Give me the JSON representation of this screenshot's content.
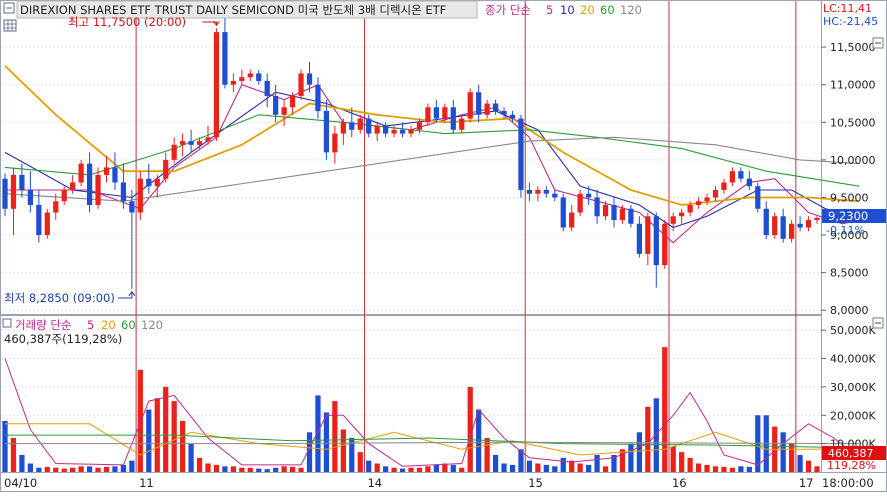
{
  "header": {
    "title": "DIREXION SHARES ETF TRUST DAILY SEMICOND  미국 반도체 3배 디렉시온 ETF",
    "ma_label": "종가 단순",
    "ma_periods": [
      "5",
      "10",
      "20",
      "60",
      "120"
    ],
    "lc": "LC:11,41",
    "hc": "HC:-21,45"
  },
  "volume_header": {
    "label": "거래량 단순",
    "ma_periods": [
      "5",
      "20",
      "60",
      "120"
    ],
    "value": "460,387주(119,28%)"
  },
  "annotations": {
    "high": "최고 11,7500 (20:00)",
    "low": "최저 8,2850 (09:00)"
  },
  "price_axis": {
    "ticks": [
      "11,5000",
      "11,0000",
      "10,5000",
      "10,0000",
      "9,5000",
      "9,0000",
      "8,5000",
      "8,0000"
    ],
    "current": "9,2300",
    "change": "-0,11%"
  },
  "volume_axis": {
    "ticks": [
      "50,000K",
      "40,000K",
      "30,000K",
      "20,000K",
      "10,000K"
    ],
    "current": "460,387",
    "pct": "119,28%"
  },
  "time_axis": {
    "labels": [
      "04/10",
      "11",
      "14",
      "15",
      "16",
      "17",
      "18:00:00"
    ]
  },
  "colors": {
    "up": "#e8231b",
    "down": "#1f4fd1",
    "ma5": "#c0288c",
    "ma10": "#2a2aa8",
    "ma20": "#e0a000",
    "ma60": "#2e9a3a",
    "ma120": "#8a8a8a",
    "session": "#c8323c"
  },
  "chart_data": {
    "type": "candlestick",
    "title": "DIREXION SHARES ETF TRUST DAILY SEMICOND  미국 반도체 3배 디렉시온 ETF",
    "ylim": [
      7.95,
      12.1
    ],
    "volume_ylim": [
      0,
      55000
    ],
    "session_labels": [
      "04/10",
      "11",
      "14",
      "15",
      "16",
      "17"
    ],
    "candles": [
      [
        9.75,
        9.82,
        9.25,
        9.35,
        18000
      ],
      [
        9.35,
        9.9,
        9.0,
        9.8,
        12000
      ],
      [
        9.8,
        9.95,
        9.5,
        9.6,
        6000
      ],
      [
        9.6,
        9.85,
        9.3,
        9.4,
        3000
      ],
      [
        9.4,
        9.6,
        8.9,
        9.0,
        1500
      ],
      [
        9.0,
        9.35,
        8.95,
        9.3,
        1800
      ],
      [
        9.3,
        9.55,
        9.2,
        9.45,
        1500
      ],
      [
        9.45,
        9.65,
        9.4,
        9.6,
        1200
      ],
      [
        9.6,
        9.8,
        9.55,
        9.7,
        1500
      ],
      [
        9.7,
        10.0,
        9.65,
        9.95,
        2000
      ],
      [
        9.95,
        10.1,
        9.3,
        9.4,
        2000
      ],
      [
        9.4,
        9.9,
        9.35,
        9.8,
        1500
      ],
      [
        9.8,
        10.05,
        9.7,
        9.9,
        1800
      ],
      [
        9.9,
        10.1,
        9.6,
        9.7,
        2000
      ],
      [
        9.7,
        9.95,
        9.35,
        9.45,
        2500
      ],
      [
        9.45,
        9.6,
        8.285,
        9.3,
        4000
      ],
      [
        9.3,
        9.85,
        9.2,
        9.75,
        36000
      ],
      [
        9.75,
        9.95,
        9.55,
        9.65,
        22000
      ],
      [
        9.65,
        9.8,
        9.5,
        9.75,
        26000
      ],
      [
        9.75,
        10.1,
        9.7,
        10.0,
        30000
      ],
      [
        10.0,
        10.3,
        9.95,
        10.2,
        25000
      ],
      [
        10.2,
        10.35,
        10.05,
        10.25,
        18000
      ],
      [
        10.25,
        10.4,
        10.1,
        10.2,
        10000
      ],
      [
        10.2,
        10.3,
        10.15,
        10.25,
        5000
      ],
      [
        10.25,
        10.45,
        10.2,
        10.3,
        3000
      ],
      [
        10.3,
        11.75,
        10.25,
        11.7,
        2500
      ],
      [
        11.7,
        11.9,
        10.95,
        11.0,
        2000
      ],
      [
        11.0,
        11.15,
        10.9,
        11.05,
        2000
      ],
      [
        11.05,
        11.2,
        11.0,
        11.1,
        1500
      ],
      [
        11.1,
        11.2,
        11.05,
        11.15,
        1500
      ],
      [
        11.15,
        11.2,
        11.0,
        11.05,
        1200
      ],
      [
        11.05,
        11.15,
        10.7,
        10.85,
        1000
      ],
      [
        10.85,
        11.0,
        10.5,
        10.6,
        1500
      ],
      [
        10.6,
        10.8,
        10.45,
        10.7,
        2000
      ],
      [
        10.7,
        10.9,
        10.6,
        10.85,
        1800
      ],
      [
        10.85,
        11.2,
        10.8,
        11.15,
        1500
      ],
      [
        11.15,
        11.3,
        10.9,
        11.0,
        14000
      ],
      [
        11.0,
        11.1,
        10.55,
        10.65,
        27000
      ],
      [
        10.65,
        10.8,
        10.0,
        10.1,
        21000
      ],
      [
        10.1,
        10.45,
        9.95,
        10.35,
        25000
      ],
      [
        10.35,
        10.55,
        10.2,
        10.5,
        15000
      ],
      [
        10.5,
        10.7,
        10.3,
        10.4,
        12000
      ],
      [
        10.4,
        10.6,
        10.35,
        10.55,
        7000
      ],
      [
        10.55,
        10.6,
        10.3,
        10.35,
        4000
      ],
      [
        10.35,
        10.5,
        10.25,
        10.45,
        3000
      ],
      [
        10.45,
        10.5,
        10.3,
        10.35,
        2000
      ],
      [
        10.35,
        10.45,
        10.3,
        10.4,
        1500
      ],
      [
        10.4,
        10.5,
        10.3,
        10.35,
        1200
      ],
      [
        10.35,
        10.45,
        10.3,
        10.4,
        1500
      ],
      [
        10.4,
        10.55,
        10.35,
        10.5,
        1500
      ],
      [
        10.5,
        10.75,
        10.45,
        10.7,
        2000
      ],
      [
        10.7,
        10.8,
        10.5,
        10.55,
        2500
      ],
      [
        10.55,
        10.75,
        10.5,
        10.7,
        3000
      ],
      [
        10.7,
        10.8,
        10.35,
        10.4,
        2500
      ],
      [
        10.4,
        10.6,
        10.35,
        10.55,
        1500
      ],
      [
        10.55,
        10.95,
        10.5,
        10.9,
        30000
      ],
      [
        10.9,
        11.0,
        10.5,
        10.6,
        22000
      ],
      [
        10.6,
        10.8,
        10.55,
        10.75,
        12000
      ],
      [
        10.75,
        10.8,
        10.6,
        10.65,
        6000
      ],
      [
        10.65,
        10.7,
        10.55,
        10.6,
        3000
      ],
      [
        10.6,
        10.65,
        10.5,
        10.55,
        2500
      ],
      [
        10.55,
        10.6,
        9.5,
        9.6,
        8000
      ],
      [
        9.6,
        9.7,
        9.45,
        9.55,
        4000
      ],
      [
        9.55,
        9.65,
        9.45,
        9.6,
        3000
      ],
      [
        9.6,
        9.65,
        9.5,
        9.55,
        2500
      ],
      [
        9.55,
        9.6,
        9.45,
        9.5,
        2000
      ],
      [
        9.5,
        9.55,
        9.05,
        9.1,
        5000
      ],
      [
        9.1,
        9.4,
        9.05,
        9.3,
        4000
      ],
      [
        9.3,
        9.6,
        9.25,
        9.55,
        3000
      ],
      [
        9.55,
        9.65,
        9.4,
        9.5,
        2500
      ],
      [
        9.5,
        9.6,
        9.15,
        9.25,
        6000
      ],
      [
        9.25,
        9.45,
        9.2,
        9.4,
        2000
      ],
      [
        9.4,
        9.5,
        9.1,
        9.2,
        6000
      ],
      [
        9.2,
        9.4,
        9.15,
        9.35,
        8000
      ],
      [
        9.35,
        9.4,
        9.1,
        9.15,
        10000
      ],
      [
        9.15,
        9.25,
        8.7,
        8.75,
        14000
      ],
      [
        8.75,
        9.3,
        8.6,
        9.25,
        23000
      ],
      [
        9.25,
        9.3,
        8.3,
        8.6,
        26000
      ],
      [
        8.6,
        9.2,
        8.55,
        9.15,
        44000
      ],
      [
        9.15,
        9.3,
        9.05,
        9.25,
        9000
      ],
      [
        9.25,
        9.35,
        9.15,
        9.3,
        7000
      ],
      [
        9.3,
        9.45,
        9.25,
        9.4,
        5000
      ],
      [
        9.4,
        9.5,
        9.35,
        9.45,
        3000
      ],
      [
        9.45,
        9.55,
        9.4,
        9.5,
        2500
      ],
      [
        9.5,
        9.65,
        9.45,
        9.6,
        2000
      ],
      [
        9.6,
        9.75,
        9.55,
        9.7,
        1800
      ],
      [
        9.7,
        9.9,
        9.65,
        9.85,
        1500
      ],
      [
        9.85,
        9.9,
        9.7,
        9.75,
        2000
      ],
      [
        9.75,
        9.85,
        9.6,
        9.65,
        1800
      ],
      [
        9.65,
        9.7,
        9.3,
        9.35,
        20000
      ],
      [
        9.35,
        9.45,
        8.95,
        9.0,
        20000
      ],
      [
        9.0,
        9.3,
        8.95,
        9.25,
        16000
      ],
      [
        9.25,
        9.35,
        8.9,
        8.95,
        14000
      ],
      [
        8.95,
        9.2,
        8.9,
        9.15,
        10000
      ],
      [
        9.15,
        9.25,
        9.05,
        9.1,
        6000
      ],
      [
        9.1,
        9.25,
        9.05,
        9.2,
        4000
      ],
      [
        9.2,
        9.25,
        9.15,
        9.23,
        2000
      ]
    ],
    "ma_series": [
      {
        "name": "5",
        "color": "#c0288c",
        "values": [
          [
            0,
            9.6
          ],
          [
            10,
            9.6
          ],
          [
            16,
            9.35
          ],
          [
            20,
            9.9
          ],
          [
            25,
            10.3
          ],
          [
            28,
            11.0
          ],
          [
            33,
            10.8
          ],
          [
            37,
            11.0
          ],
          [
            40,
            10.5
          ],
          [
            48,
            10.4
          ],
          [
            54,
            10.6
          ],
          [
            58,
            10.7
          ],
          [
            62,
            10.3
          ],
          [
            65,
            9.6
          ],
          [
            70,
            9.45
          ],
          [
            75,
            9.3
          ],
          [
            79,
            8.9
          ],
          [
            83,
            9.3
          ],
          [
            88,
            9.7
          ],
          [
            91,
            9.75
          ],
          [
            95,
            9.3
          ],
          [
            99,
            9.15
          ],
          [
            101,
            9.2
          ]
        ]
      },
      {
        "name": "10",
        "color": "#2a2aa8",
        "values": [
          [
            0,
            10.1
          ],
          [
            8,
            9.6
          ],
          [
            15,
            9.5
          ],
          [
            22,
            10.1
          ],
          [
            27,
            10.5
          ],
          [
            32,
            10.9
          ],
          [
            38,
            10.75
          ],
          [
            45,
            10.45
          ],
          [
            52,
            10.55
          ],
          [
            58,
            10.65
          ],
          [
            63,
            10.4
          ],
          [
            68,
            9.65
          ],
          [
            75,
            9.4
          ],
          [
            79,
            9.1
          ],
          [
            83,
            9.25
          ],
          [
            89,
            9.6
          ],
          [
            93,
            9.6
          ],
          [
            97,
            9.35
          ],
          [
            101,
            9.2
          ]
        ]
      },
      {
        "name": "20",
        "color": "#e0a000",
        "values": [
          [
            0,
            11.25
          ],
          [
            6,
            10.6
          ],
          [
            14,
            9.85
          ],
          [
            20,
            9.85
          ],
          [
            28,
            10.2
          ],
          [
            36,
            10.75
          ],
          [
            44,
            10.6
          ],
          [
            52,
            10.5
          ],
          [
            60,
            10.55
          ],
          [
            66,
            10.1
          ],
          [
            74,
            9.6
          ],
          [
            80,
            9.4
          ],
          [
            88,
            9.5
          ],
          [
            95,
            9.5
          ],
          [
            101,
            9.45
          ]
        ]
      },
      {
        "name": "60",
        "color": "#2e9a3a",
        "values": [
          [
            0,
            9.9
          ],
          [
            10,
            9.8
          ],
          [
            20,
            10.15
          ],
          [
            30,
            10.6
          ],
          [
            40,
            10.5
          ],
          [
            52,
            10.35
          ],
          [
            62,
            10.4
          ],
          [
            70,
            10.3
          ],
          [
            80,
            10.15
          ],
          [
            90,
            9.85
          ],
          [
            101,
            9.65
          ]
        ]
      },
      {
        "name": "120",
        "color": "#8a8a8a",
        "values": [
          [
            0,
            9.55
          ],
          [
            14,
            9.45
          ],
          [
            26,
            9.65
          ],
          [
            38,
            9.85
          ],
          [
            50,
            10.05
          ],
          [
            62,
            10.25
          ],
          [
            72,
            10.3
          ],
          [
            84,
            10.2
          ],
          [
            94,
            10.0
          ],
          [
            101,
            9.95
          ]
        ]
      }
    ],
    "vol_ma_series": [
      {
        "name": "5",
        "color": "#c0288c",
        "values": [
          [
            0,
            40000
          ],
          [
            3,
            15000
          ],
          [
            6,
            3000
          ],
          [
            14,
            2500
          ],
          [
            17,
            25000
          ],
          [
            20,
            27000
          ],
          [
            24,
            12000
          ],
          [
            28,
            2500
          ],
          [
            35,
            2500
          ],
          [
            38,
            20000
          ],
          [
            40,
            20000
          ],
          [
            43,
            10000
          ],
          [
            47,
            2000
          ],
          [
            54,
            3000
          ],
          [
            56,
            22000
          ],
          [
            59,
            12000
          ],
          [
            62,
            5000
          ],
          [
            67,
            3500
          ],
          [
            72,
            5000
          ],
          [
            76,
            10000
          ],
          [
            79,
            20000
          ],
          [
            81,
            28000
          ],
          [
            83,
            18000
          ],
          [
            85,
            6000
          ],
          [
            89,
            2500
          ],
          [
            92,
            10000
          ],
          [
            95,
            17000
          ],
          [
            98,
            12000
          ],
          [
            101,
            5000
          ]
        ]
      },
      {
        "name": "20",
        "color": "#e0a000",
        "values": [
          [
            0,
            17000
          ],
          [
            10,
            17000
          ],
          [
            16,
            6000
          ],
          [
            22,
            14000
          ],
          [
            30,
            10000
          ],
          [
            38,
            8000
          ],
          [
            46,
            14000
          ],
          [
            54,
            8000
          ],
          [
            60,
            11000
          ],
          [
            68,
            6000
          ],
          [
            78,
            8000
          ],
          [
            84,
            14000
          ],
          [
            90,
            8000
          ],
          [
            96,
            8000
          ],
          [
            101,
            9000
          ]
        ]
      },
      {
        "name": "60",
        "color": "#2e9a3a",
        "values": [
          [
            0,
            13000
          ],
          [
            20,
            13000
          ],
          [
            34,
            11000
          ],
          [
            50,
            12000
          ],
          [
            66,
            10000
          ],
          [
            84,
            9500
          ],
          [
            101,
            8500
          ]
        ]
      },
      {
        "name": "120",
        "color": "#8a8a8a",
        "values": [
          [
            0,
            10000
          ],
          [
            30,
            10000
          ],
          [
            60,
            10500
          ],
          [
            101,
            10000
          ]
        ]
      }
    ],
    "high_index": 25,
    "low_index": 15,
    "session_starts": [
      16,
      43,
      62,
      79,
      94
    ]
  }
}
